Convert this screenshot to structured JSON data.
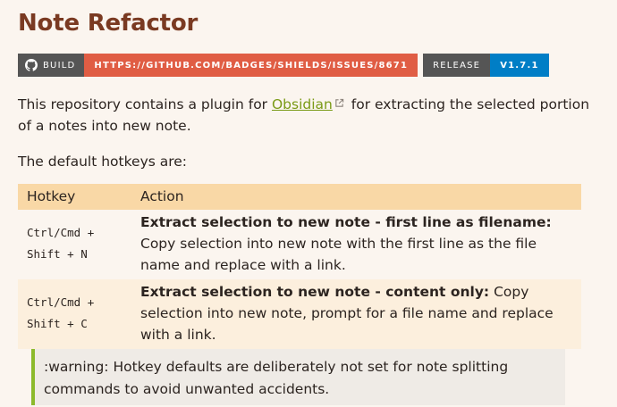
{
  "title": "Note Refactor",
  "badges": {
    "build": {
      "label": "BUILD",
      "value": "HTTPS://GITHUB.COM/BADGES/SHIELDS/ISSUES/8671",
      "icon": "github-icon",
      "value_color": "#e05d44"
    },
    "release": {
      "label": "RELEASE",
      "value": "V1.7.1",
      "value_color": "#007ec6"
    }
  },
  "intro": {
    "before": "This repository contains a plugin for ",
    "link_text": "Obsidian",
    "after": " for extracting the selected portion of a notes into new note."
  },
  "hotkeys_lead": "The default hotkeys are:",
  "table": {
    "headers": [
      "Hotkey",
      "Action"
    ],
    "rows": [
      {
        "hotkey": "Ctrl/Cmd +\nShift + N",
        "action_bold": "Extract selection to new note - first line as filename:",
        "action_text": " Copy selection into new note with the first line as the file name and replace with a link."
      },
      {
        "hotkey": "Ctrl/Cmd +\nShift + C",
        "action_bold": "Extract selection to new note - content only:",
        "action_text": " Copy selection into new note, prompt for a file name and replace with a link."
      }
    ]
  },
  "callout": ":warning: Hotkey defaults are deliberately not set for note splitting commands to avoid unwanted accidents.",
  "colors": {
    "title": "#7a3a22",
    "link": "#7a9a16",
    "table_header": "#f9d8a6",
    "callout_border": "#8cba2c"
  }
}
